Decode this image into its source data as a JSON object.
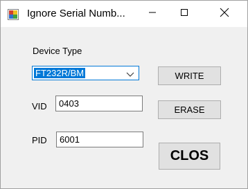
{
  "window": {
    "title": "Ignore Serial Numb...",
    "icon": "app-window-icon",
    "controls": {
      "minimize": "minimize-icon",
      "maximize": "maximize-icon",
      "close": "close-icon"
    }
  },
  "form": {
    "device_type_label": "Device Type",
    "device_type_value": "FT232R/BM",
    "vid_label": "VID",
    "vid_value": "0403",
    "pid_label": "PID",
    "pid_value": "6001"
  },
  "buttons": {
    "write": "WRITE",
    "erase": "ERASE",
    "close": "CLOS"
  },
  "colors": {
    "selection": "#0078d7",
    "button_face": "#e1e1e1",
    "dialog_background": "#f0f0f0"
  }
}
